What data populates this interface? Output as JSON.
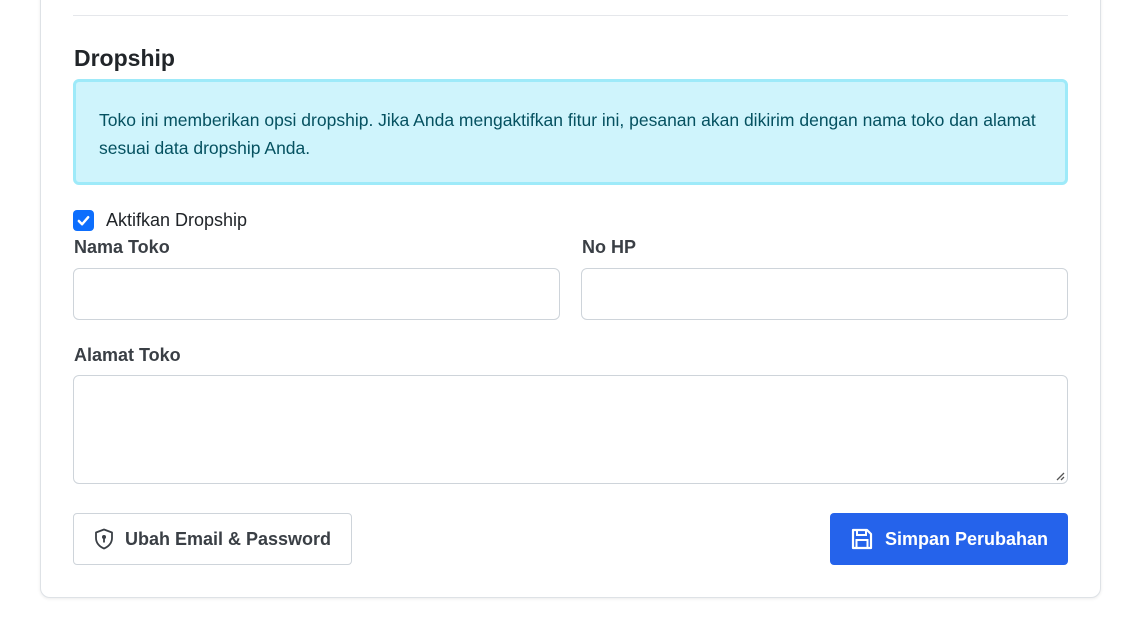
{
  "dropship": {
    "title": "Dropship",
    "info_text": "Toko ini memberikan opsi dropship. Jika Anda mengaktifkan fitur ini, pesanan akan dikirim dengan nama toko dan alamat sesuai data dropship Anda.",
    "enable_label": "Aktifkan Dropship",
    "enabled": true,
    "fields": {
      "store_name_label": "Nama Toko",
      "store_name_value": "",
      "phone_label": "No HP",
      "phone_value": "",
      "address_label": "Alamat Toko",
      "address_value": ""
    }
  },
  "actions": {
    "change_credentials_label": "Ubah Email & Password",
    "change_credentials_icon": "shield-icon",
    "save_label": "Simpan Perubahan",
    "save_icon": "save-icon"
  },
  "colors": {
    "primary": "#2563eb",
    "info_bg": "#cff4fc",
    "info_border": "#9eeaf9",
    "info_text": "#055160",
    "checkbox": "#0d6efd"
  }
}
